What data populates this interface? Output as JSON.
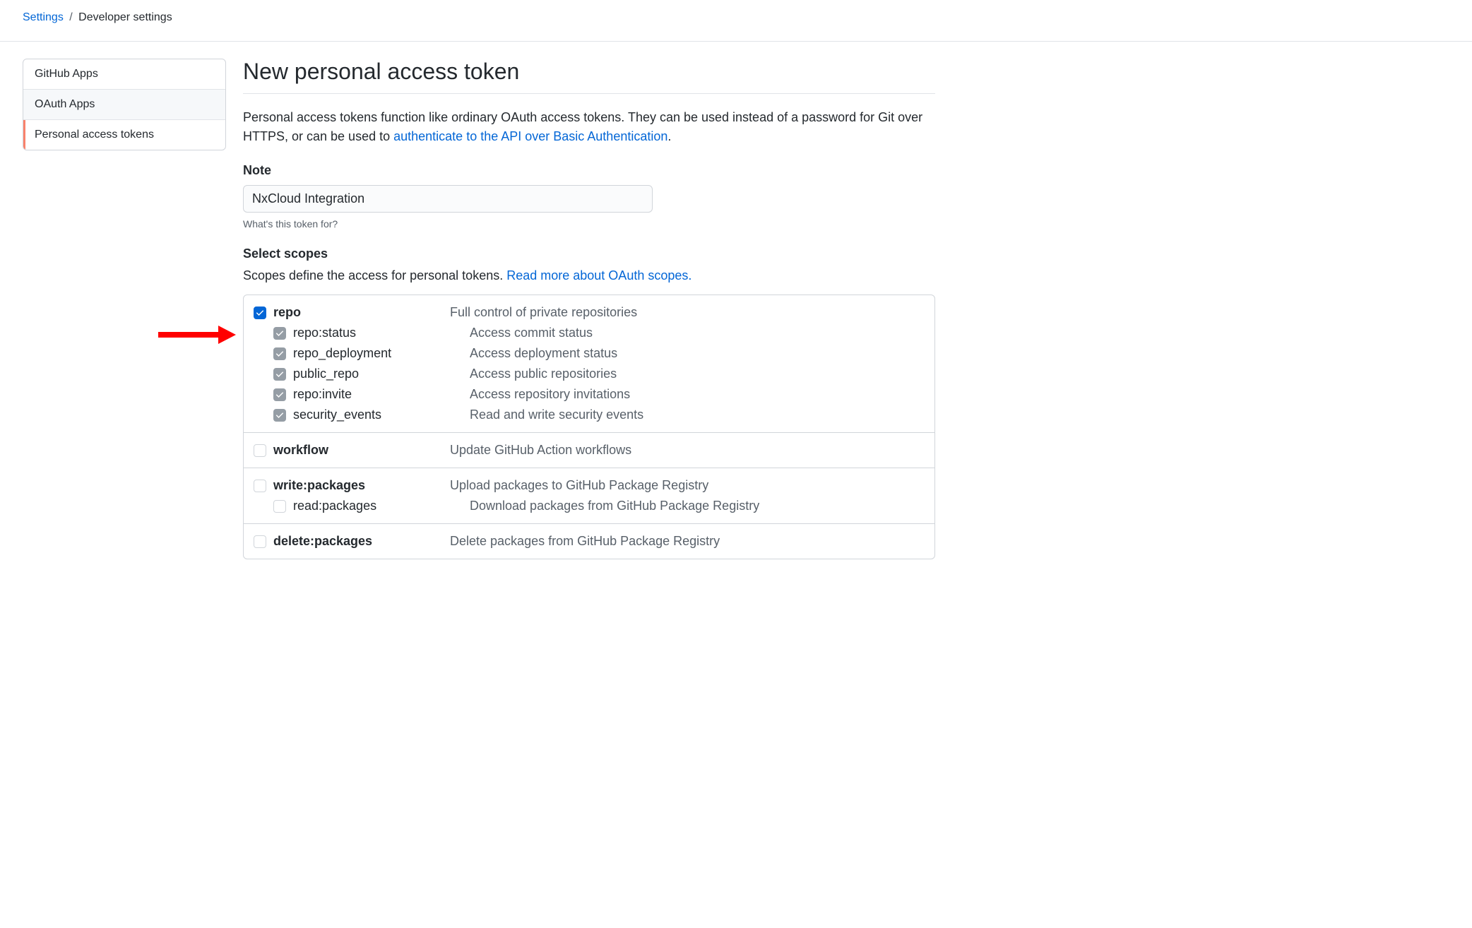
{
  "breadcrumb": {
    "parent": "Settings",
    "current": "Developer settings"
  },
  "sidebar": {
    "items": [
      {
        "label": "GitHub Apps"
      },
      {
        "label": "OAuth Apps"
      },
      {
        "label": "Personal access tokens"
      }
    ]
  },
  "page": {
    "title": "New personal access token",
    "intro_prefix": "Personal access tokens function like ordinary OAuth access tokens. They can be used instead of a password for Git over HTTPS, or can be used to ",
    "intro_link": "authenticate to the API over Basic Authentication",
    "intro_suffix": "."
  },
  "note": {
    "label": "Note",
    "value": "NxCloud Integration",
    "help": "What's this token for?"
  },
  "scopes": {
    "label": "Select scopes",
    "desc_prefix": "Scopes define the access for personal tokens. ",
    "desc_link": "Read more about OAuth scopes.",
    "groups": [
      {
        "name": "repo",
        "desc": "Full control of private repositories",
        "checked": true,
        "children": [
          {
            "name": "repo:status",
            "desc": "Access commit status"
          },
          {
            "name": "repo_deployment",
            "desc": "Access deployment status"
          },
          {
            "name": "public_repo",
            "desc": "Access public repositories"
          },
          {
            "name": "repo:invite",
            "desc": "Access repository invitations"
          },
          {
            "name": "security_events",
            "desc": "Read and write security events"
          }
        ]
      },
      {
        "name": "workflow",
        "desc": "Update GitHub Action workflows",
        "checked": false,
        "children": []
      },
      {
        "name": "write:packages",
        "desc": "Upload packages to GitHub Package Registry",
        "checked": false,
        "children": [
          {
            "name": "read:packages",
            "desc": "Download packages from GitHub Package Registry"
          }
        ]
      },
      {
        "name": "delete:packages",
        "desc": "Delete packages from GitHub Package Registry",
        "checked": false,
        "children": []
      }
    ]
  }
}
